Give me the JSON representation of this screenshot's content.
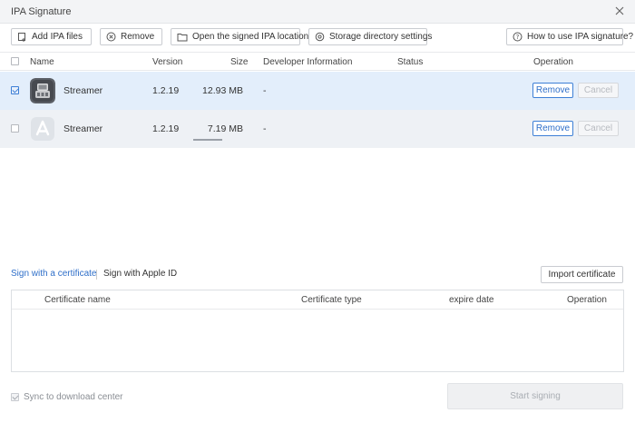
{
  "window": {
    "title": "IPA Signature"
  },
  "toolbar": {
    "add": "Add IPA files",
    "remove": "Remove",
    "open_location": "Open the signed IPA location",
    "storage": "Storage directory settings",
    "help": "How to use IPA signature?"
  },
  "table": {
    "headers": {
      "name": "Name",
      "version": "Version",
      "size": "Size",
      "developer": "Developer Information",
      "status": "Status",
      "operation": "Operation"
    },
    "rows": [
      {
        "checked": true,
        "name": "Streamer",
        "version": "1.2.19",
        "size": "12.93 MB",
        "developer": "-",
        "status": "",
        "remove": "Remove",
        "cancel": "Cancel",
        "icon": "streamer-app-icon"
      },
      {
        "checked": false,
        "name": "Streamer",
        "version": "1.2.19",
        "size": "7.19 MB",
        "developer": "-",
        "status": "",
        "remove": "Remove",
        "cancel": "Cancel",
        "icon": "app-store-placeholder-icon"
      }
    ]
  },
  "sign": {
    "tab_certificate": "Sign with a certificate",
    "tab_apple_id": "Sign with Apple ID",
    "import": "Import certificate",
    "headers": {
      "cert_name": "Certificate name",
      "cert_type": "Certificate type",
      "expire": "expire date",
      "operation": "Operation"
    }
  },
  "footer": {
    "sync_label": "Sync to download center",
    "sync_checked": true,
    "start": "Start signing"
  },
  "colors": {
    "accent": "#2f6fc9",
    "selected_row": "#e3eefb"
  }
}
